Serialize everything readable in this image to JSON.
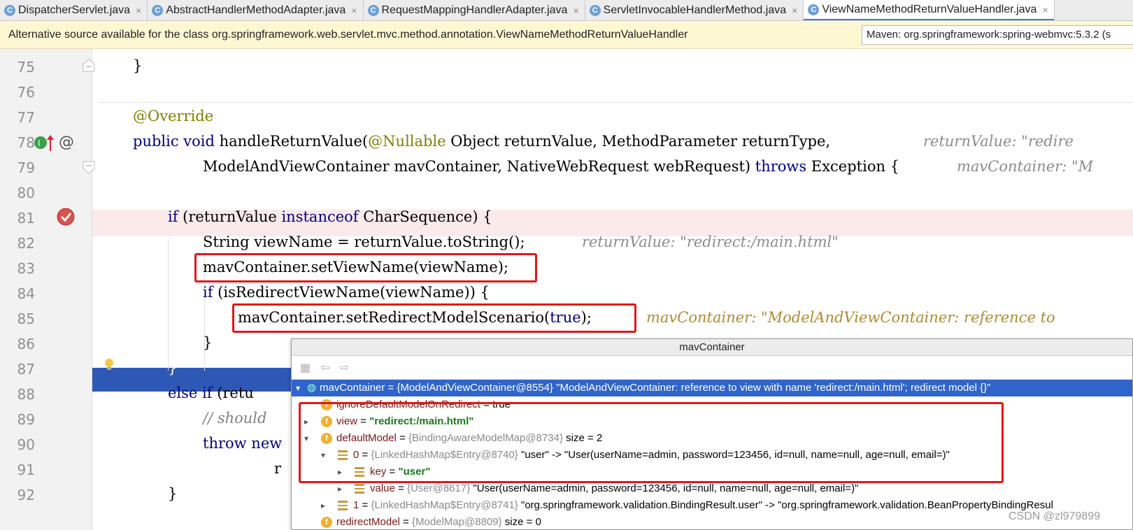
{
  "tabs": [
    {
      "label": "DispatcherServlet.java",
      "active": false
    },
    {
      "label": "AbstractHandlerMethodAdapter.java",
      "active": false
    },
    {
      "label": "RequestMappingHandlerAdapter.java",
      "active": false
    },
    {
      "label": "ServletInvocableHandlerMethod.java",
      "active": false
    },
    {
      "label": "ViewNameMethodReturnValueHandler.java",
      "active": true
    }
  ],
  "tab_icon_letter": "C",
  "tab_close": "×",
  "notice": {
    "text": "Alternative source available for the class org.springframework.web.servlet.mvc.method.annotation.ViewNameMethodReturnValueHandler",
    "maven": "Maven: org.springframework:spring-webmvc:5.3.2 (s"
  },
  "line_numbers": [
    "75",
    "76",
    "77",
    "78",
    "79",
    "80",
    "81",
    "82",
    "83",
    "84",
    "85",
    "86",
    "87",
    "88",
    "89",
    "90",
    "91",
    "92"
  ],
  "code": {
    "l75": "}",
    "l77": "@Override",
    "l78_kw": "public void",
    "l78_rest": " handleReturnValue(",
    "l78_ann": "@Nullable",
    "l78_tail": " Object returnValue, MethodParameter returnType,",
    "l78_hint": "returnValue: \"redire",
    "l79_a": "ModelAndViewContainer mavContainer, NativeWebRequest webRequest) ",
    "l79_kw": "throws",
    "l79_b": " Exception {",
    "l79_hint": "mavContainer: \"M",
    "l81_kw1": "if",
    "l81_a": " (returnValue ",
    "l81_kw2": "instanceof",
    "l81_b": " CharSequence) {",
    "l82": "String viewName = returnValue.toString();",
    "l82_hint": "returnValue: \"redirect:/main.html\"",
    "l83": "mavContainer.setViewName(viewName);",
    "l84_kw": "if",
    "l84_rest": " (isRedirectViewName(viewName)) {",
    "l85_a": "mavContainer.setRedirectModelScenario(",
    "l85_kw": "true",
    "l85_b": ");",
    "l85_hint": "mavContainer: \"ModelAndViewContainer: reference to",
    "l86": "}",
    "l87": "}",
    "l88_kw": "else if",
    "l88_rest": " (retu",
    "l89": "// should",
    "l90_kw": "throw",
    "l90_rest": " new",
    "l91": "r",
    "l92": "}"
  },
  "popup": {
    "title": "mavContainer",
    "rows": [
      {
        "name": "mavContainer",
        "eq": " = ",
        "type": "{ModelAndViewContainer@8554}",
        "value": " \"ModelAndViewContainer: reference to view with name 'redirect:/main.html'; redirect model {}\""
      },
      {
        "name": "ignoreDefaultModelOnRedirect",
        "eq": " = ",
        "type": "",
        "value": "true"
      },
      {
        "name": "view",
        "eq": " = ",
        "type": "",
        "value": "\"redirect:/main.html\""
      },
      {
        "name": "defaultModel",
        "eq": " = ",
        "type": "{BindingAwareModelMap@8734}",
        "value": "  size = 2"
      },
      {
        "name": "0",
        "eq": " = ",
        "type": "{LinkedHashMap$Entry@8740}",
        "value": " \"user\" -> \"User(userName=admin, password=123456, id=null, name=null, age=null, email=)\""
      },
      {
        "name": "key",
        "eq": " = ",
        "type": "",
        "value": "\"user\""
      },
      {
        "name": "value",
        "eq": " = ",
        "type": "{User@8617}",
        "value": " \"User(userName=admin, password=123456, id=null, name=null, age=null, email=)\""
      },
      {
        "name": "1",
        "eq": " = ",
        "type": "{LinkedHashMap$Entry@8741}",
        "value": " \"org.springframework.validation.BindingResult.user\" -> \"org.springframework.validation.BeanPropertyBindingResul"
      },
      {
        "name": "redirectModel",
        "eq": " = ",
        "type": "{ModelMap@8809}",
        "value": "  size = 0"
      }
    ]
  },
  "icons": {
    "field": "f"
  },
  "watermark": "CSDN @zl979899"
}
